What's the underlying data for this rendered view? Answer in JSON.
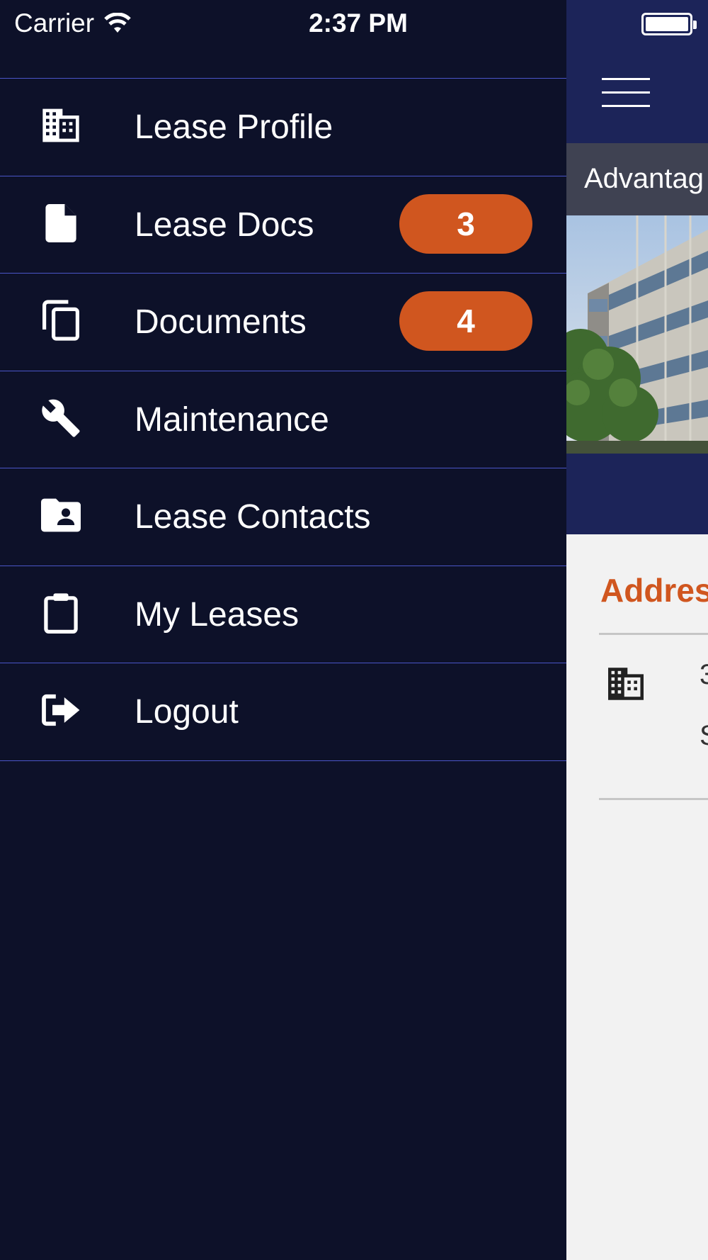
{
  "status_bar": {
    "carrier": "Carrier",
    "time": "2:37 PM"
  },
  "menu": {
    "items": [
      {
        "label": "Lease Profile",
        "icon": "building-icon",
        "badge": null
      },
      {
        "label": "Lease Docs",
        "icon": "file-icon",
        "badge": "3"
      },
      {
        "label": "Documents",
        "icon": "copy-documents-icon",
        "badge": "4"
      },
      {
        "label": "Maintenance",
        "icon": "wrench-icon",
        "badge": null
      },
      {
        "label": "Lease Contacts",
        "icon": "contact-folder-icon",
        "badge": null
      },
      {
        "label": "My Leases",
        "icon": "clipboard-icon",
        "badge": null
      },
      {
        "label": "Logout",
        "icon": "logout-icon",
        "badge": null
      }
    ]
  },
  "main": {
    "property_name": "Advantag",
    "address_title": "Addres",
    "address_line1": "3",
    "address_line2": "S"
  },
  "colors": {
    "drawer_bg": "#0d1129",
    "header_bg": "#1c2459",
    "divider": "#4a55c8",
    "badge": "#d0561f",
    "accent_title": "#d0561f"
  }
}
